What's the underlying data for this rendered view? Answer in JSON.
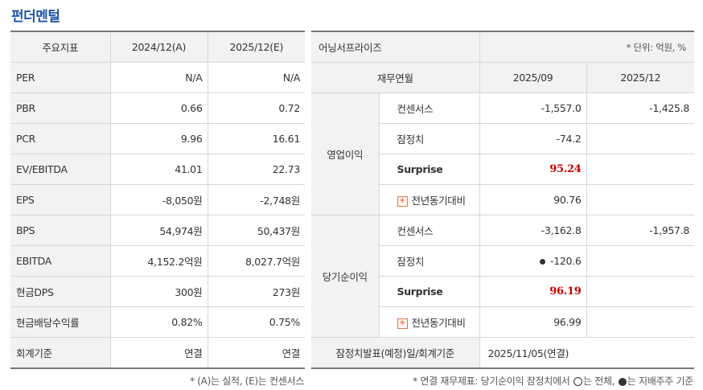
{
  "section_title": "펀더멘털",
  "fundamentals": {
    "header": [
      "주요지표",
      "2024/12(A)",
      "2025/12(E)"
    ],
    "rows": [
      {
        "label": "PER",
        "a": "N/A",
        "e": "N/A"
      },
      {
        "label": "PBR",
        "a": "0.66",
        "e": "0.72"
      },
      {
        "label": "PCR",
        "a": "9.96",
        "e": "16.61"
      },
      {
        "label": "EV/EBITDA",
        "a": "41.01",
        "e": "22.73"
      },
      {
        "label": "EPS",
        "a": "-8,050원",
        "e": "-2,748원"
      },
      {
        "label": "BPS",
        "a": "54,974원",
        "e": "50,437원"
      },
      {
        "label": "EBITDA",
        "a": "4,152.2억원",
        "e": "8,027.7억원"
      },
      {
        "label": "현금DPS",
        "a": "300원",
        "e": "273원"
      },
      {
        "label": "현금배당수익률",
        "a": "0.82%",
        "e": "0.75%"
      },
      {
        "label": "회계기준",
        "a": "연결",
        "e": "연결"
      }
    ],
    "footnote": "* (A)는 실적, (E)는 컨센서스"
  },
  "earnings_surprise": {
    "title": "어닝서프라이즈",
    "unit": "* 단위: 억원, %",
    "period_header": "재무연월",
    "periods": [
      "2025/09",
      "2025/12"
    ],
    "groups": [
      {
        "name": "영업이익",
        "rows": [
          {
            "label": "컨센서스",
            "v1": "-1,557.0",
            "v2": "-1,425.8"
          },
          {
            "label": "잠정치",
            "v1": "-74.2",
            "v2": ""
          },
          {
            "label": "Surprise",
            "v1": "95.24",
            "v2": ""
          },
          {
            "label": "전년동기대비",
            "v1": "90.76",
            "v2": ""
          }
        ]
      },
      {
        "name": "당기순이익",
        "rows": [
          {
            "label": "컨센서스",
            "v1": "-3,162.8",
            "v2": "-1,957.8"
          },
          {
            "label": "잠정치",
            "v1": "-120.6",
            "v2": ""
          },
          {
            "label": "Surprise",
            "v1": "96.19",
            "v2": ""
          },
          {
            "label": "전년동기대비",
            "v1": "96.99",
            "v2": ""
          }
        ]
      }
    ],
    "announce_label": "잠정치발표(예정)일/회계기준",
    "announce_value": "2025/11/05(연결)",
    "footnote_a": "* 연결 재무제표: 당기순이익 잠정치에서",
    "footnote_b": "는 전체,",
    "footnote_c": "는 지배주주 기준"
  }
}
